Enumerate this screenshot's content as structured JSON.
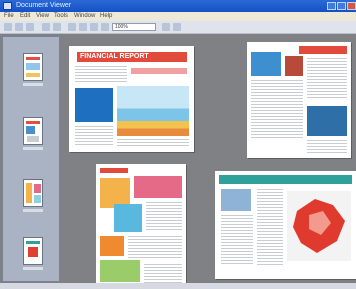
{
  "window": {
    "title": "Document Viewer"
  },
  "menu": {
    "items": [
      "File",
      "Edit",
      "View",
      "Tools",
      "Window",
      "Help"
    ]
  },
  "toolbar": {
    "zoom_value": "100%"
  },
  "pages": {
    "p1_heading": "FINANCIAL REPORT"
  },
  "colors": {
    "titlebar": "#1a58cc",
    "workspace": "#808184",
    "accent_red": "#e03a2f"
  }
}
